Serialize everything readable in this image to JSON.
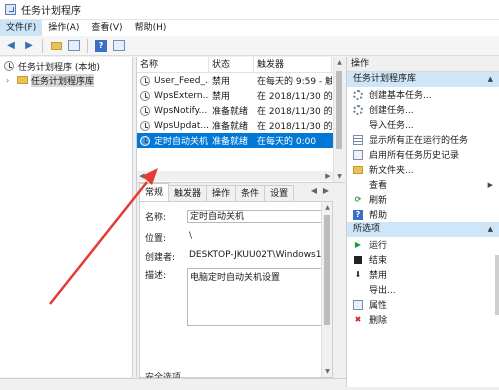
{
  "window": {
    "title": "任务计划程序"
  },
  "menu": [
    "文件(F)",
    "操作(A)",
    "查看(V)",
    "帮助(H)"
  ],
  "tree": {
    "root": "任务计划程序 (本地)",
    "child": "任务计划程序库"
  },
  "task_list": {
    "headers": {
      "name": "名称",
      "status": "状态",
      "trigger": "触发器"
    },
    "rows": [
      {
        "name": "User_Feed_...",
        "status": "禁用",
        "trigger": "在每天的 9:59 - 触"
      },
      {
        "name": "WpsExtern...",
        "status": "禁用",
        "trigger": "在 2018/11/30 的 8"
      },
      {
        "name": "WpsNotify...",
        "status": "准备就绪",
        "trigger": "在 2018/11/30 的 8"
      },
      {
        "name": "WpsUpdat...",
        "status": "准备就绪",
        "trigger": "在 2018/11/30 的 8"
      },
      {
        "name": "定时自动关机",
        "status": "准备就绪",
        "trigger": "在每天的 0:00"
      }
    ]
  },
  "details": {
    "tabs": [
      "常规",
      "触发器",
      "操作",
      "条件",
      "设置"
    ],
    "name_label": "名称:",
    "name_value": "定时自动关机",
    "location_label": "位置:",
    "location_value": "\\",
    "author_label": "创建者:",
    "author_value": "DESKTOP-JKUU02T\\Windows10",
    "desc_label": "描述:",
    "desc_value": "电脑定时自动关机设置",
    "security_hint": "安全选项"
  },
  "actions": {
    "title": "操作",
    "section1": "任务计划程序库",
    "items1": [
      {
        "label": "创建基本任务...",
        "icon": "gear-icon"
      },
      {
        "label": "创建任务...",
        "icon": "gear-icon"
      },
      {
        "label": "导入任务...",
        "icon": "blank-icon"
      },
      {
        "label": "显示所有正在运行的任务",
        "icon": "list-icon"
      },
      {
        "label": "启用所有任务历史记录",
        "icon": "doc-icon"
      },
      {
        "label": "新文件夹...",
        "icon": "folder-icon"
      },
      {
        "label": "查看",
        "icon": "blank-icon"
      },
      {
        "label": "刷新",
        "icon": "refresh-icon"
      },
      {
        "label": "帮助",
        "icon": "help-icon"
      }
    ],
    "section2": "所选项",
    "items2": [
      {
        "label": "运行",
        "icon": "run-icon"
      },
      {
        "label": "结束",
        "icon": "stop-icon"
      },
      {
        "label": "禁用",
        "icon": "disable-icon"
      },
      {
        "label": "导出...",
        "icon": "blank-icon"
      },
      {
        "label": "属性",
        "icon": "properties-icon"
      },
      {
        "label": "删除",
        "icon": "delete-icon"
      }
    ]
  },
  "colors": {
    "selection": "#0078d7",
    "section_header": "#cfe6f8",
    "annotation_arrow": "#e53935"
  }
}
